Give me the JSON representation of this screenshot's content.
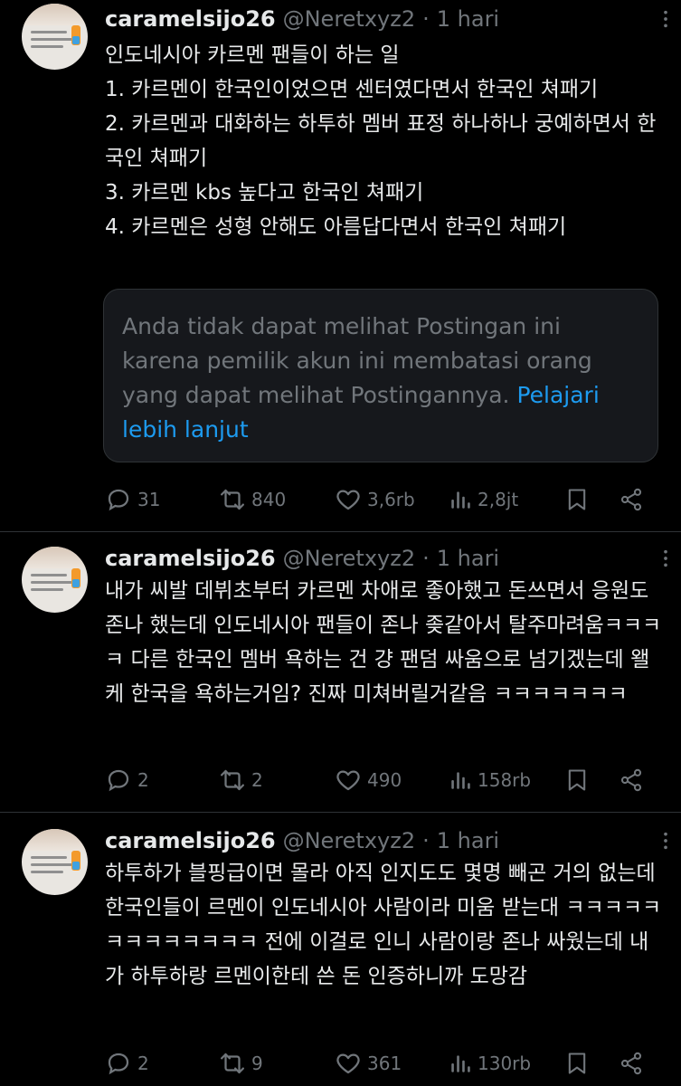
{
  "tweets": [
    {
      "name": "caramelsijo26",
      "handle": "@Neretxyz2",
      "time": "1 hari",
      "text": "인도네시아 카르멘 팬들이 하는 일\n1. 카르멘이 한국인이었으면 센터였다면서 한국인 쳐패기\n2. 카르멘과 대화하는 하투하 멤버 표정 하나하나 궁예하면서 한국인 쳐패기\n3. 카르멘 kbs 높다고 한국인 쳐패기\n4. 카르멘은 성형 안해도 아름답다면서 한국인 쳐패기",
      "quote_text": "Anda tidak dapat melihat Postingan ini karena pemilik akun ini membatasi orang yang dapat melihat Postingannya.",
      "quote_link": "Pelajari lebih lanjut",
      "replies": "31",
      "reposts": "840",
      "likes": "3,6rb",
      "views": "2,8jt"
    },
    {
      "name": "caramelsijo26",
      "handle": "@Neretxyz2",
      "time": "1 hari",
      "text": "내가 씨발 데뷔초부터 카르멘 차애로 좋아했고 돈쓰면서 응원도 존나 했는데 인도네시아 팬들이 존나 좆같아서 탈주마려움ㅋㅋㅋㅋ 다른 한국인 멤버 욕하는 건 걍 팬덤 싸움으로 넘기겠는데 왤케 한국을 욕하는거임? 진짜 미쳐버릴거같음 ㅋㅋㅋㅋㅋㅋㅋ",
      "replies": "2",
      "reposts": "2",
      "likes": "490",
      "views": "158rb"
    },
    {
      "name": "caramelsijo26",
      "handle": "@Neretxyz2",
      "time": "1 hari",
      "text": "하투하가 블핑급이면 몰라 아직 인지도도 몇명 빼곤 거의 없는데 한국인들이 르멘이 인도네시아 사람이라 미움 받는대 ㅋㅋㅋㅋㅋㅋㅋㅋㅋㅋㅋㅋㅋ 전에 이걸로 인니 사람이랑 존나 싸웠는데 내가 하투하랑 르멘이한테 쓴 돈 인증하니까 도망감",
      "replies": "2",
      "reposts": "9",
      "likes": "361",
      "views": "130rb"
    }
  ],
  "colors": {
    "background": "#000000",
    "text": "#e7e9ea",
    "muted": "#71767b",
    "link": "#1d9bf0",
    "border": "#2f3336"
  },
  "icons": {
    "reply": "reply-icon",
    "repost": "repost-icon",
    "like": "heart-icon",
    "views": "views-icon",
    "bookmark": "bookmark-icon",
    "share": "share-icon",
    "more": "more-icon"
  }
}
